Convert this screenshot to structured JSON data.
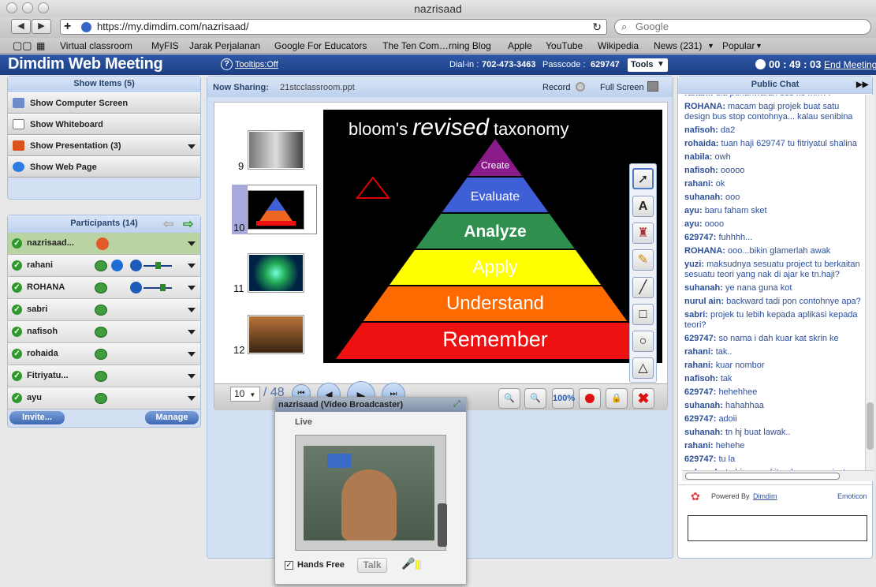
{
  "browser": {
    "window_title": "nazrisaad",
    "url": "https://my.dimdim.com/nazrisaad/",
    "search_placeholder": "Google",
    "bookmarks": [
      "Virtual classroom",
      "MyFIS",
      "Jarak Perjalanan",
      "Google For Educators",
      "The Ten Com…rning Blog",
      "Apple",
      "YouTube",
      "Wikipedia",
      "News (231)",
      "Popular"
    ]
  },
  "header": {
    "brand": "Dimdim Web Meeting",
    "tooltips": "Tooltips:Off",
    "dialin_label": "Dial-in :",
    "dialin": "702-473-3463",
    "passcode_label": "Passcode :",
    "passcode": "629747",
    "tools": "Tools",
    "timer": "00 : 49 : 03",
    "end": "End Meeting"
  },
  "show_items": {
    "title": "Show Items (5)",
    "items": [
      "Show Computer Screen",
      "Show Whiteboard",
      "Show Presentation (3)",
      "Show Web Page"
    ]
  },
  "participants": {
    "title": "Participants (14)",
    "list": [
      "nazrisaad...",
      "rahani",
      "ROHANA",
      "sabri",
      "nafisoh",
      "rohaida",
      "Fitriyatu...",
      "ayu"
    ],
    "invite": "Invite...",
    "manage": "Manage"
  },
  "sharing": {
    "label": "Now Sharing:",
    "file": "21stcclassroom.ppt",
    "record": "Record",
    "fullscreen": "Full Screen",
    "page": "10",
    "total": "/ 48",
    "thumb_nums": [
      "9",
      "10",
      "11",
      "12"
    ],
    "zoom": "100%"
  },
  "slide": {
    "title_a": "bloom's ",
    "title_b": "revised",
    "title_c": " taxonomy",
    "levels": [
      "Create",
      "Evaluate",
      "Analyze",
      "Apply",
      "Understand",
      "Remember"
    ],
    "colors": [
      "#8b1a8b",
      "#3f5fd6",
      "#2f8f4e",
      "#ffff00",
      "#ff6a00",
      "#ee1111"
    ]
  },
  "video": {
    "title": "nazrisaad (Video Broadcaster)",
    "live": "Live",
    "handsfree": "Hands Free",
    "talk": "Talk"
  },
  "chat": {
    "title": "Public Chat",
    "powered": "Powered By",
    "dimdim": "Dimdim",
    "emoticon": "Emoticon",
    "messages": [
      {
        "u": "rahani:",
        "t": "dia punahwarah bsb ke mm??"
      },
      {
        "u": "ROHANA:",
        "t": "macam bagi projek buat satu design bus stop contohnya... kalau senibina"
      },
      {
        "u": "nafisoh:",
        "t": "da2"
      },
      {
        "u": "rohaida:",
        "t": "tuan haji 629747 tu fitriyatul shalina"
      },
      {
        "u": "nabila:",
        "t": "owh"
      },
      {
        "u": "nafisoh:",
        "t": "ooooo"
      },
      {
        "u": "rahani:",
        "t": "ok"
      },
      {
        "u": "suhanah:",
        "t": "ooo"
      },
      {
        "u": "ayu:",
        "t": "baru faham sket"
      },
      {
        "u": "ayu:",
        "t": "oooo"
      },
      {
        "u": "629747:",
        "t": "fuhhhh..."
      },
      {
        "u": "ROHANA:",
        "t": "ooo...bikin glamerlah awak"
      },
      {
        "u": "yuzi:",
        "t": "maksudnya sesuatu project tu berkaitan sesuatu teori yang nak di ajar ke tn.haji?"
      },
      {
        "u": "suhanah:",
        "t": "ye nana guna kot"
      },
      {
        "u": "nurul ain:",
        "t": "backward tadi pon contohnye apa?"
      },
      {
        "u": "sabri:",
        "t": "projek tu lebih kepada aplikasi kepada teori?"
      },
      {
        "u": "629747:",
        "t": "so nama i dah kuar kat skrin ke"
      },
      {
        "u": "rahani:",
        "t": "tak.."
      },
      {
        "u": "rahani:",
        "t": "kuar nombor"
      },
      {
        "u": "nafisoh:",
        "t": "tak"
      },
      {
        "u": "629747:",
        "t": "hehehhee"
      },
      {
        "u": "suhanah:",
        "t": "hahahhaa"
      },
      {
        "u": "629747:",
        "t": "adoii"
      },
      {
        "u": "suhanah:",
        "t": "tn hj buat lawak.."
      },
      {
        "u": "rahani:",
        "t": "hehehe"
      },
      {
        "u": "629747:",
        "t": "tu la"
      },
      {
        "u": "suhanah:",
        "t": "tn hjcamne kite nk guna project learning tu?"
      }
    ]
  }
}
